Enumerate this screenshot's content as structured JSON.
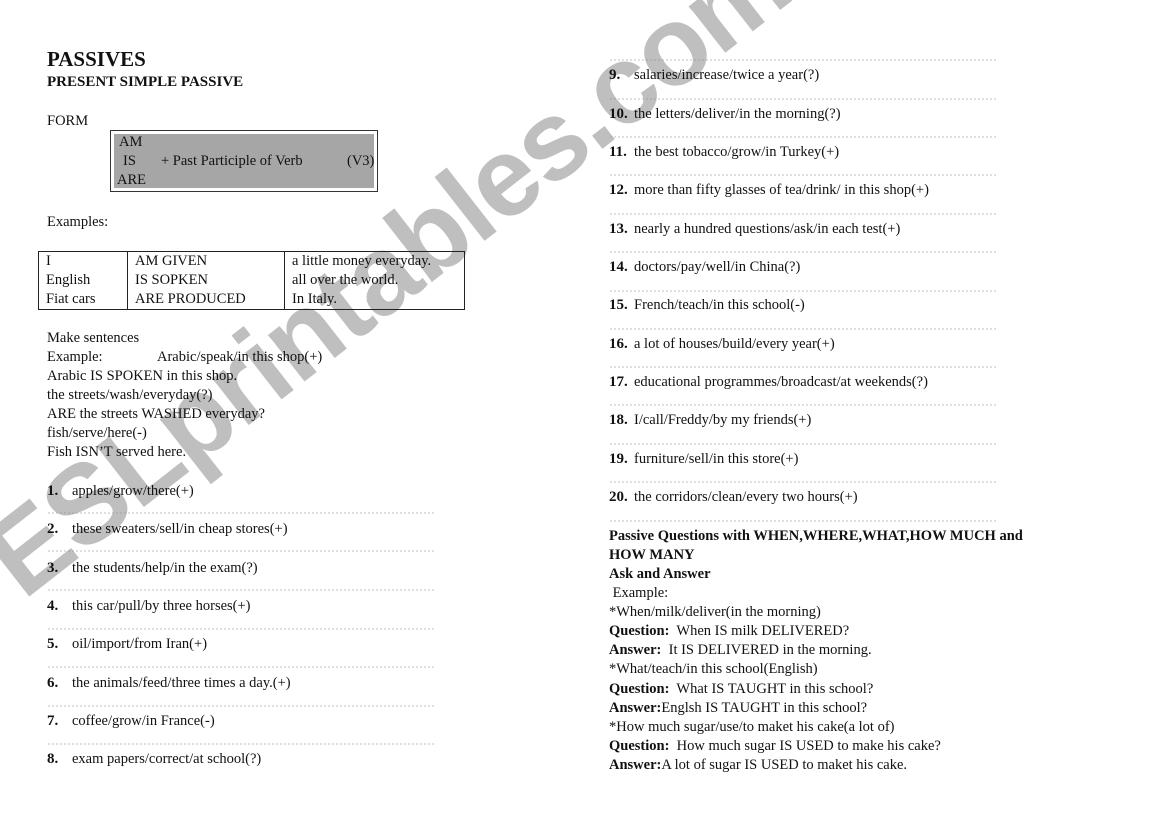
{
  "header": {
    "title": "PASSIVES",
    "subtitle": "PRESENT SIMPLE PASSIVE"
  },
  "form": {
    "label": "FORM",
    "verbs": [
      "AM",
      "IS",
      "ARE"
    ],
    "rule": "+ Past Participle of Verb",
    "code": "(V3)"
  },
  "examples": {
    "label": "Examples:",
    "rows": [
      {
        "subject": "I",
        "verb": "AM GIVEN",
        "rest": "a little money everyday."
      },
      {
        "subject": "English",
        "verb": "IS SOPKEN",
        "rest": "all over the world."
      },
      {
        "subject": "Fiat cars",
        "verb": "ARE PRODUCED",
        "rest": "In Italy."
      }
    ]
  },
  "make_sentences": {
    "heading": "Make sentences",
    "example_label": "Example:",
    "example_prompt": "Arabic/speak/in this shop(+)",
    "lines": [
      "Arabic IS SPOKEN in this shop.",
      "the streets/wash/everyday(?)",
      "ARE the streets WASHED everyday?",
      "fish/serve/here(-)",
      "Fish ISN’T served here."
    ]
  },
  "exercises": [
    {
      "num": "1.",
      "text": "apples/grow/there(+)"
    },
    {
      "num": "2.",
      "text": "these sweaters/sell/in cheap stores(+)"
    },
    {
      "num": "3.",
      "text": "the students/help/in the exam(?)"
    },
    {
      "num": "4.",
      "text": "this car/pull/by three horses(+)"
    },
    {
      "num": "5.",
      "text": "oil/import/from Iran(+)"
    },
    {
      "num": "6.",
      "text": "the animals/feed/three times a day.(+)"
    },
    {
      "num": "7.",
      "text": "coffee/grow/in France(-)"
    },
    {
      "num": "8.",
      "text": "exam papers/correct/at school(?)"
    },
    {
      "num": "9.",
      "text": "salaries/increase/twice a year(?)"
    },
    {
      "num": "10.",
      "text": "the letters/deliver/in the morning(?)"
    },
    {
      "num": "11.",
      "text": "the best tobacco/grow/in Turkey(+)"
    },
    {
      "num": "12.",
      "text": "more than fifty glasses of tea/drink/ in this shop(+)"
    },
    {
      "num": "13.",
      "text": "nearly a hundred questions/ask/in each test(+)"
    },
    {
      "num": "14.",
      "text": "doctors/pay/well/in China(?)"
    },
    {
      "num": "15.",
      "text": "French/teach/in this school(-)"
    },
    {
      "num": "16.",
      "text": "a lot of houses/build/every year(+)"
    },
    {
      "num": "17.",
      "text": "educational programmes/broadcast/at weekends(?)"
    },
    {
      "num": "18.",
      "text": "I/call/Freddy/by my friends(+)"
    },
    {
      "num": "19.",
      "text": "furniture/sell/in this store(+)"
    },
    {
      "num": "20.",
      "text": "the corridors/clean/every two hours(+)"
    }
  ],
  "questions_section": {
    "heading_line1": "Passive Questions with WHEN,WHERE,WHAT,HOW MUCH and",
    "heading_line2": "HOW MANY",
    "subheading": "Ask and Answer",
    "example_label": " Example:",
    "items": [
      {
        "prompt": "*When/milk/deliver(in the morning)",
        "question_label": "Question:",
        "question": "When IS milk DELIVERED?",
        "answer_label": "Answer:",
        "answer": "It IS DELIVERED in the morning."
      },
      {
        "prompt": "*What/teach/in this school(English)",
        "question_label": "Question:",
        "question": "What IS TAUGHT in this school?",
        "answer_label": "Answer:",
        "answer": "Englsh IS TAUGHT in this school?"
      },
      {
        "prompt": "*How much sugar/use/to maket his cake(a lot of)",
        "question_label": "Question:",
        "question": "How much sugar IS USED to make his cake?",
        "answer_label": "Answer:",
        "answer": "A lot of sugar IS USED to maket his cake."
      }
    ]
  },
  "watermark": "ESLprintables.com"
}
